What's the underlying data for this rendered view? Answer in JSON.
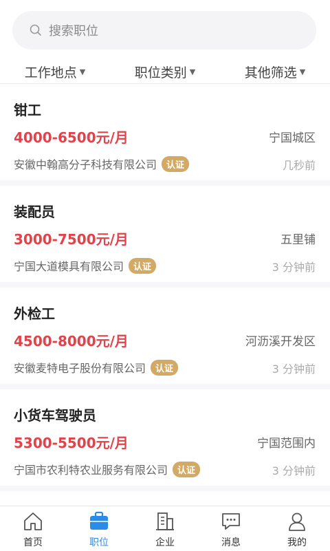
{
  "search": {
    "placeholder": "搜索职位"
  },
  "filters": [
    {
      "label": "工作地点"
    },
    {
      "label": "职位类别"
    },
    {
      "label": "其他筛选"
    }
  ],
  "jobs": [
    {
      "title": "钳工",
      "salary": "4000-6500元/月",
      "location": "宁国城区",
      "company": "安徽中翰高分子科技有限公司",
      "badge": "认证",
      "time": "几秒前"
    },
    {
      "title": "装配员",
      "salary": "3000-7500元/月",
      "location": "五里铺",
      "company": "宁国大道模具有限公司",
      "badge": "认证",
      "time": "3 分钟前"
    },
    {
      "title": "外检工",
      "salary": "4500-8000元/月",
      "location": "河沥溪开发区",
      "company": "安徽麦特电子股份有限公司",
      "badge": "认证",
      "time": "3 分钟前"
    },
    {
      "title": "小货车驾驶员",
      "salary": "5300-5500元/月",
      "location": "宁国范围内",
      "company": "宁国市农利特农业服务有限公司",
      "badge": "认证",
      "time": "3 分钟前"
    }
  ],
  "tabs": [
    {
      "label": "首页",
      "icon": "home-icon"
    },
    {
      "label": "职位",
      "icon": "briefcase-icon",
      "active": true
    },
    {
      "label": "企业",
      "icon": "building-icon"
    },
    {
      "label": "消息",
      "icon": "message-icon"
    },
    {
      "label": "我的",
      "icon": "user-icon"
    }
  ],
  "colors": {
    "accent": "#2a8ce8",
    "salary": "#e2424a",
    "badge": "#d3a966"
  }
}
